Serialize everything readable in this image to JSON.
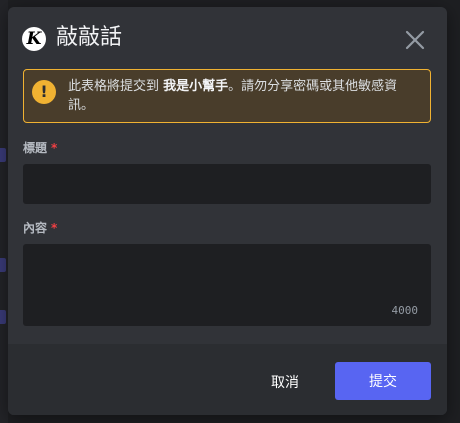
{
  "modal": {
    "title": "敲敲話",
    "logo_letter": "K"
  },
  "warning": {
    "icon": "!",
    "text_before": "此表格將提交到 ",
    "bot_name": "我是小幫手",
    "text_after": "。請勿分享密碼或其他敏感資訊。"
  },
  "fields": {
    "title_label": "標題",
    "content_label": "內容",
    "required_mark": "*",
    "title_value": "",
    "content_value": "",
    "char_limit": "4000"
  },
  "footer": {
    "cancel_label": "取消",
    "submit_label": "提交"
  },
  "colors": {
    "accent": "#5865f2",
    "warning_border": "#f0b232",
    "required": "#f23f43"
  },
  "icons": {
    "logo": "app-logo-icon",
    "close": "close-icon",
    "warning": "warning-icon"
  }
}
